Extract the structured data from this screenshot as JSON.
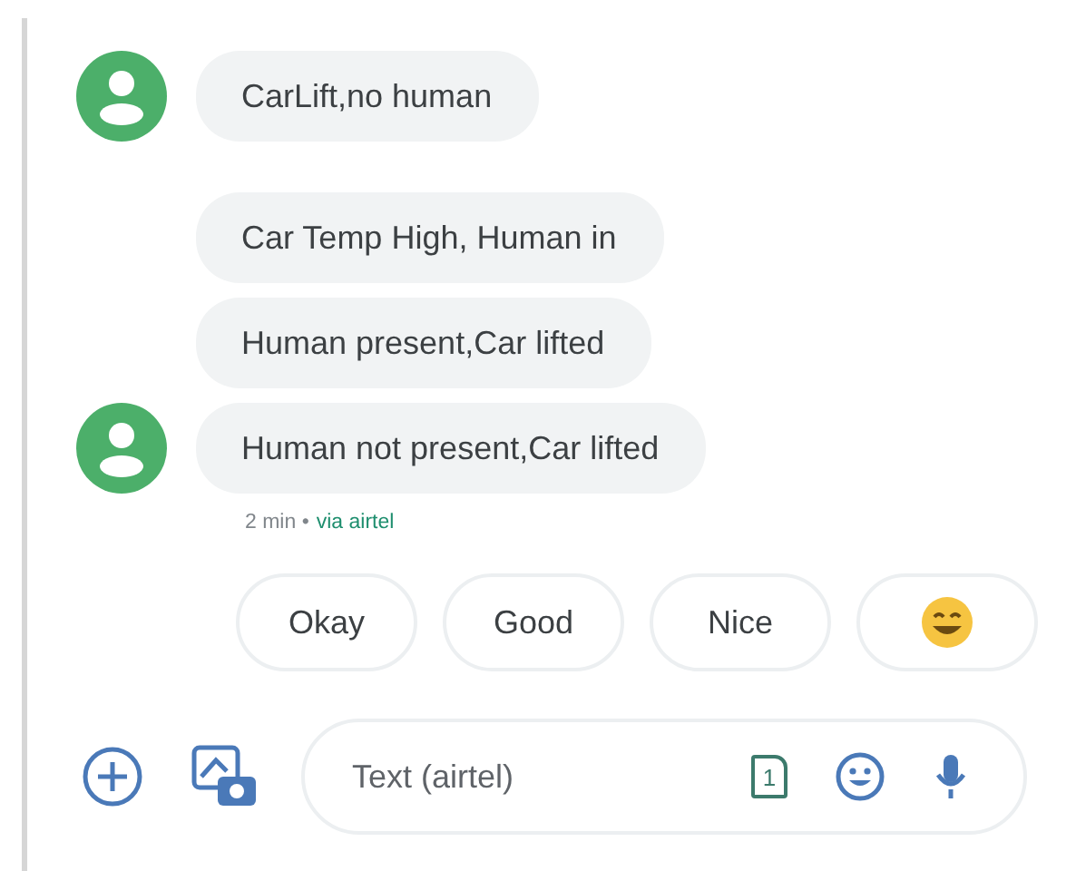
{
  "messages": [
    {
      "text": "CarLift,no human",
      "avatar": true
    },
    {
      "text": "Car Temp High, Human in",
      "avatar": false
    },
    {
      "text": "Human present,Car lifted",
      "avatar": false
    },
    {
      "text": "Human not present,Car lifted",
      "avatar": true
    }
  ],
  "meta": {
    "time": "2 min •",
    "via": "via airtel"
  },
  "suggestions": [
    {
      "kind": "text",
      "label": "Okay"
    },
    {
      "kind": "text",
      "label": "Good"
    },
    {
      "kind": "text",
      "label": "Nice"
    },
    {
      "kind": "emoji"
    }
  ],
  "compose": {
    "placeholder": "Text (airtel)",
    "sim": "1"
  }
}
